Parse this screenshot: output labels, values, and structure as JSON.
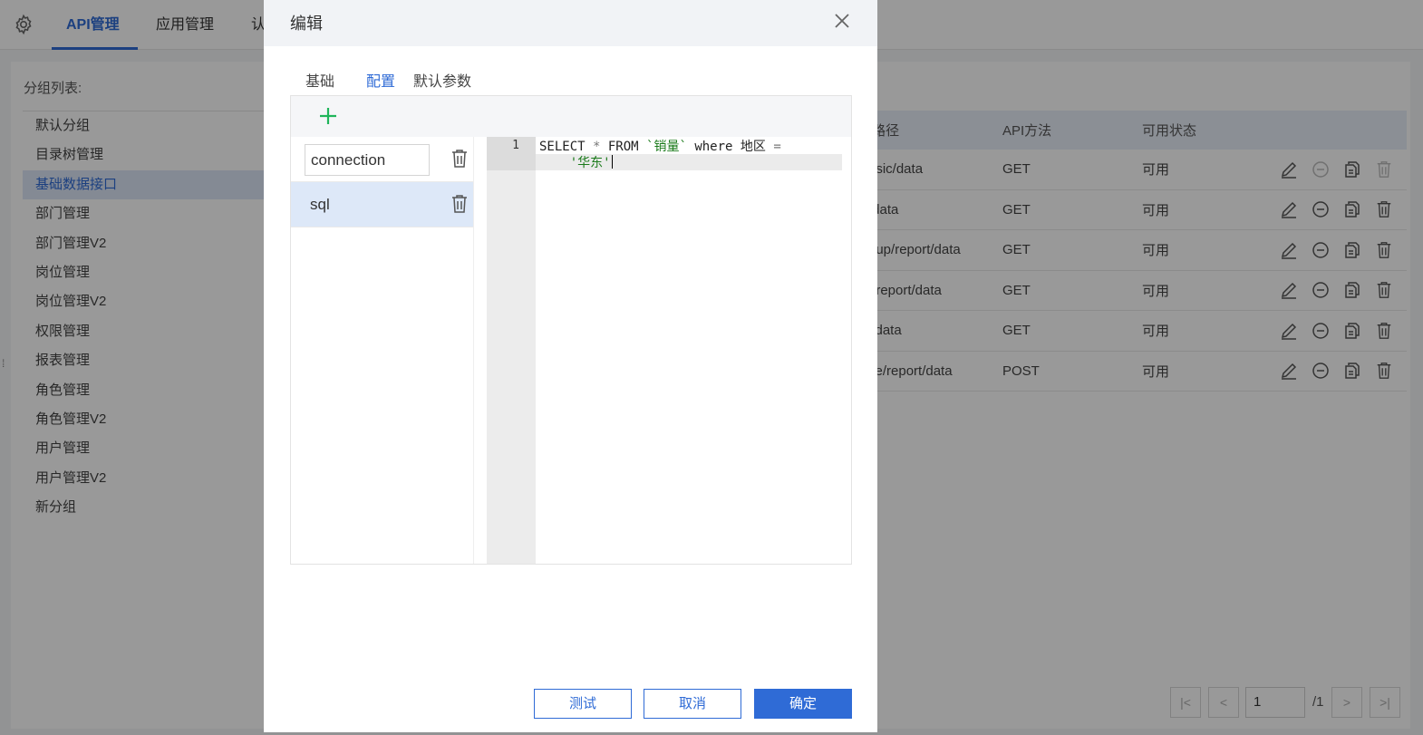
{
  "nav": {
    "tabs": [
      {
        "label": "API管理"
      },
      {
        "label": "应用管理"
      },
      {
        "label": "认"
      }
    ]
  },
  "groups": {
    "title": "分组列表:",
    "items": [
      "默认分组",
      "目录树管理",
      "基础数据接口",
      "部门管理",
      "部门管理V2",
      "岗位管理",
      "岗位管理V2",
      "权限管理",
      "报表管理",
      "角色管理",
      "角色管理V2",
      "用户管理",
      "用户管理V2",
      "新分组"
    ],
    "active_index": 2
  },
  "table": {
    "headers": {
      "path": "I路径",
      "method": "API方法",
      "status": "可用状态"
    },
    "rows": [
      {
        "path": "asic/data",
        "method": "GET",
        "status": "可用"
      },
      {
        "path": "/data",
        "method": "GET",
        "status": "可用"
      },
      {
        "path": "oup/report/data",
        "method": "GET",
        "status": "可用"
      },
      {
        "path": "t/report/data",
        "method": "GET",
        "status": "可用"
      },
      {
        "path": "l/data",
        "method": "GET",
        "status": "可用"
      },
      {
        "path": "ite/report/data",
        "method": "POST",
        "status": "可用"
      }
    ]
  },
  "pagination": {
    "page": "1",
    "total": "/1"
  },
  "modal": {
    "title": "编辑",
    "tabs": [
      {
        "label": "基础"
      },
      {
        "label": "配置"
      },
      {
        "label": "默认参数"
      }
    ],
    "active_tab": "配置",
    "params": [
      {
        "name": "connection"
      },
      {
        "name": "sql"
      }
    ],
    "editor": {
      "line_number": "1",
      "code_parts": [
        "SELECT ",
        "*",
        " FROM ",
        "`销量`",
        " where 地区 ",
        "=",
        "\n    ",
        "'华东'"
      ]
    },
    "buttons": {
      "test": "测试",
      "cancel": "取消",
      "ok": "确定"
    }
  },
  "colors": {
    "accent": "#2f6bd6",
    "add_green": "#1fb55a",
    "string_green": "#1a7a1a"
  }
}
